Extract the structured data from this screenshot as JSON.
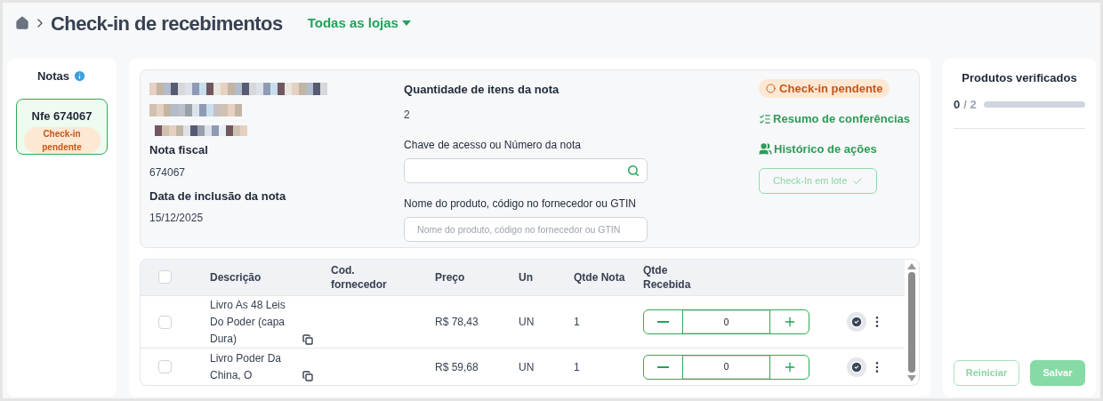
{
  "header": {
    "title": "Check-in de recebimentos",
    "store_filter": "Todas as lojas"
  },
  "notes_panel": {
    "title": "Notas",
    "items": [
      {
        "number": "Nfe 674067",
        "status": "Check-in pendente",
        "selected": true
      }
    ]
  },
  "note": {
    "fields": [
      {
        "label": "Nota fiscal",
        "value": "674067"
      },
      {
        "label": "Data de inclusão da nota",
        "value": "15/12/2025"
      }
    ],
    "item_count": {
      "label": "Quantidade de itens da nota",
      "value": "2"
    },
    "access_key": {
      "label": "Chave de acesso ou Número da nota"
    },
    "product_search": {
      "label": "Nome do produto, código no fornecedor ou GTIN",
      "placeholder": "Nome do produto, código no fornecedor ou GTIN"
    },
    "status": "Check-in pendente",
    "links": [
      {
        "kind": "checklist",
        "label": "Resumo de conferências"
      },
      {
        "kind": "users",
        "label": "Histórico de ações"
      }
    ],
    "batch_button": {
      "label": "Check-In em lote",
      "disabled": true
    }
  },
  "table": {
    "all_checked": false,
    "columns": [
      "Descrição",
      "Cod. fornecedor",
      "Preço",
      "Un",
      "Qtde Nota",
      "Qtde Recebida"
    ],
    "rows": [
      {
        "checked": false,
        "description": "Livro As 48 Leis Do Poder (capa Dura)",
        "price": "R$ 78,43",
        "unit": "UN",
        "qty": "1",
        "received": "0"
      },
      {
        "checked": false,
        "description": "Livro Poder Da China, O",
        "price": "R$ 59,68",
        "unit": "UN",
        "qty": "1",
        "received": "0"
      }
    ]
  },
  "verified": {
    "title": "Produtos verificados",
    "done": "0",
    "total": "/ 2",
    "level": 0,
    "buttons": [
      {
        "kind": "outline",
        "label": "Reiniciar",
        "disabled": true
      },
      {
        "kind": "solid",
        "label": "Salvar",
        "disabled": true
      }
    ]
  }
}
